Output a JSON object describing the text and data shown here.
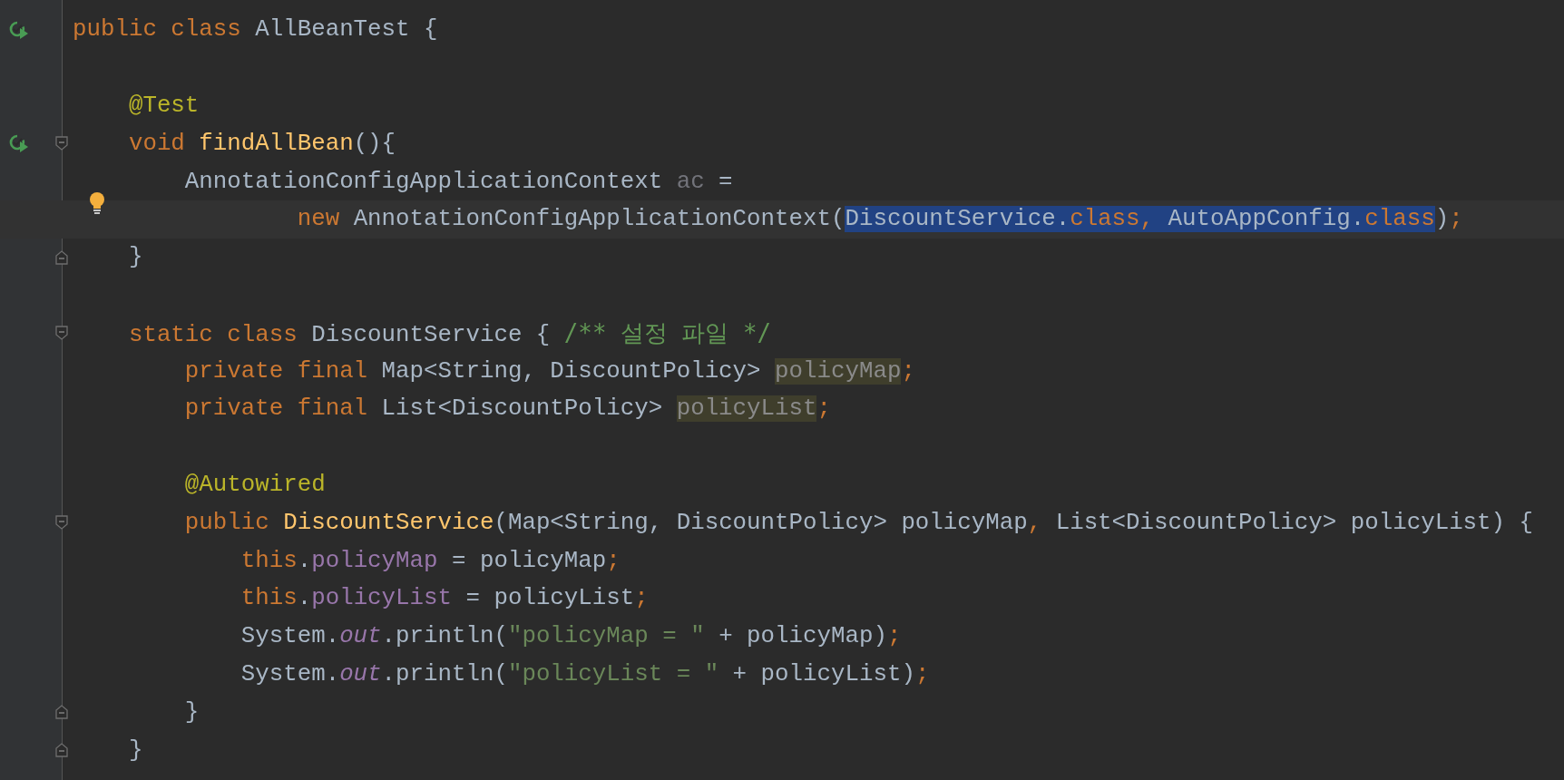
{
  "editor": {
    "lines": [
      {
        "kind": "code",
        "run": true,
        "tokens": [
          {
            "kind": "keyword",
            "text": "public class "
          },
          {
            "kind": "plain",
            "text": "AllBeanTest {"
          }
        ]
      },
      {
        "kind": "blank"
      },
      {
        "kind": "code",
        "tokens": [
          {
            "kind": "annotation",
            "text": "    @Test"
          }
        ]
      },
      {
        "kind": "code",
        "run": true,
        "fold_start": true,
        "tokens": [
          {
            "kind": "keyword",
            "text": "    void "
          },
          {
            "kind": "method",
            "text": "findAllBean"
          },
          {
            "kind": "plain",
            "text": "(){"
          }
        ]
      },
      {
        "kind": "code",
        "tokens": [
          {
            "kind": "plain",
            "text": "        AnnotationConfigApplicationContext "
          },
          {
            "kind": "unused",
            "text": "ac"
          },
          {
            "kind": "plain",
            "text": " ="
          }
        ]
      },
      {
        "kind": "code",
        "current": true,
        "bulb": true,
        "tokens": [
          {
            "kind": "keyword",
            "text": "                new "
          },
          {
            "kind": "plain",
            "text": "AnnotationConfigApplicationContext("
          },
          {
            "kind": "plain",
            "text": "DiscountService.",
            "selected": true
          },
          {
            "kind": "keyword",
            "text": "class",
            "selected": true
          },
          {
            "kind": "keyword",
            "text": ", ",
            "selected": true
          },
          {
            "kind": "plain",
            "text": "AutoAppConfig.",
            "selected": true
          },
          {
            "kind": "keyword",
            "text": "class",
            "selected": true
          },
          {
            "kind": "plain",
            "text": ")"
          },
          {
            "kind": "keyword",
            "text": ";"
          }
        ]
      },
      {
        "kind": "code",
        "fold_end": true,
        "tokens": [
          {
            "kind": "plain",
            "text": "    }"
          }
        ]
      },
      {
        "kind": "blank"
      },
      {
        "kind": "code",
        "fold_start": true,
        "tokens": [
          {
            "kind": "keyword",
            "text": "    static class "
          },
          {
            "kind": "plain",
            "text": "DiscountService { "
          },
          {
            "kind": "comment",
            "text": "/** 설정 파일 */"
          }
        ]
      },
      {
        "kind": "code",
        "tokens": [
          {
            "kind": "keyword",
            "text": "        private final "
          },
          {
            "kind": "plain",
            "text": "Map<String, DiscountPolicy> "
          },
          {
            "kind": "unused-field",
            "text": "policyMap"
          },
          {
            "kind": "keyword",
            "text": ";"
          }
        ]
      },
      {
        "kind": "code",
        "tokens": [
          {
            "kind": "keyword",
            "text": "        private final "
          },
          {
            "kind": "plain",
            "text": "List<DiscountPolicy> "
          },
          {
            "kind": "unused-field",
            "text": "policyList"
          },
          {
            "kind": "keyword",
            "text": ";"
          }
        ]
      },
      {
        "kind": "blank"
      },
      {
        "kind": "code",
        "tokens": [
          {
            "kind": "annotation",
            "text": "        @Autowired"
          }
        ]
      },
      {
        "kind": "code",
        "fold_start": true,
        "tokens": [
          {
            "kind": "keyword",
            "text": "        public "
          },
          {
            "kind": "method",
            "text": "DiscountService"
          },
          {
            "kind": "plain",
            "text": "(Map<String, DiscountPolicy> policyMap"
          },
          {
            "kind": "keyword",
            "text": ", "
          },
          {
            "kind": "plain",
            "text": "List<DiscountPolicy> policyList) {"
          }
        ]
      },
      {
        "kind": "code",
        "tokens": [
          {
            "kind": "keyword",
            "text": "            this"
          },
          {
            "kind": "plain",
            "text": "."
          },
          {
            "kind": "field",
            "text": "policyMap"
          },
          {
            "kind": "plain",
            "text": " = policyMap"
          },
          {
            "kind": "keyword",
            "text": ";"
          }
        ]
      },
      {
        "kind": "code",
        "tokens": [
          {
            "kind": "keyword",
            "text": "            this"
          },
          {
            "kind": "plain",
            "text": "."
          },
          {
            "kind": "field",
            "text": "policyList"
          },
          {
            "kind": "plain",
            "text": " = policyList"
          },
          {
            "kind": "keyword",
            "text": ";"
          }
        ]
      },
      {
        "kind": "code",
        "tokens": [
          {
            "kind": "plain",
            "text": "            System."
          },
          {
            "kind": "static-field",
            "text": "out"
          },
          {
            "kind": "plain",
            "text": ".println("
          },
          {
            "kind": "string",
            "text": "\"policyMap = \""
          },
          {
            "kind": "plain",
            "text": " + policyMap)"
          },
          {
            "kind": "keyword",
            "text": ";"
          }
        ]
      },
      {
        "kind": "code",
        "tokens": [
          {
            "kind": "plain",
            "text": "            System."
          },
          {
            "kind": "static-field",
            "text": "out"
          },
          {
            "kind": "plain",
            "text": ".println("
          },
          {
            "kind": "string",
            "text": "\"policyList = \""
          },
          {
            "kind": "plain",
            "text": " + policyList)"
          },
          {
            "kind": "keyword",
            "text": ";"
          }
        ]
      },
      {
        "kind": "code",
        "fold_end": true,
        "tokens": [
          {
            "kind": "plain",
            "text": "        }"
          }
        ]
      },
      {
        "kind": "code",
        "fold_end": true,
        "tokens": [
          {
            "kind": "plain",
            "text": "    }"
          }
        ]
      }
    ]
  }
}
